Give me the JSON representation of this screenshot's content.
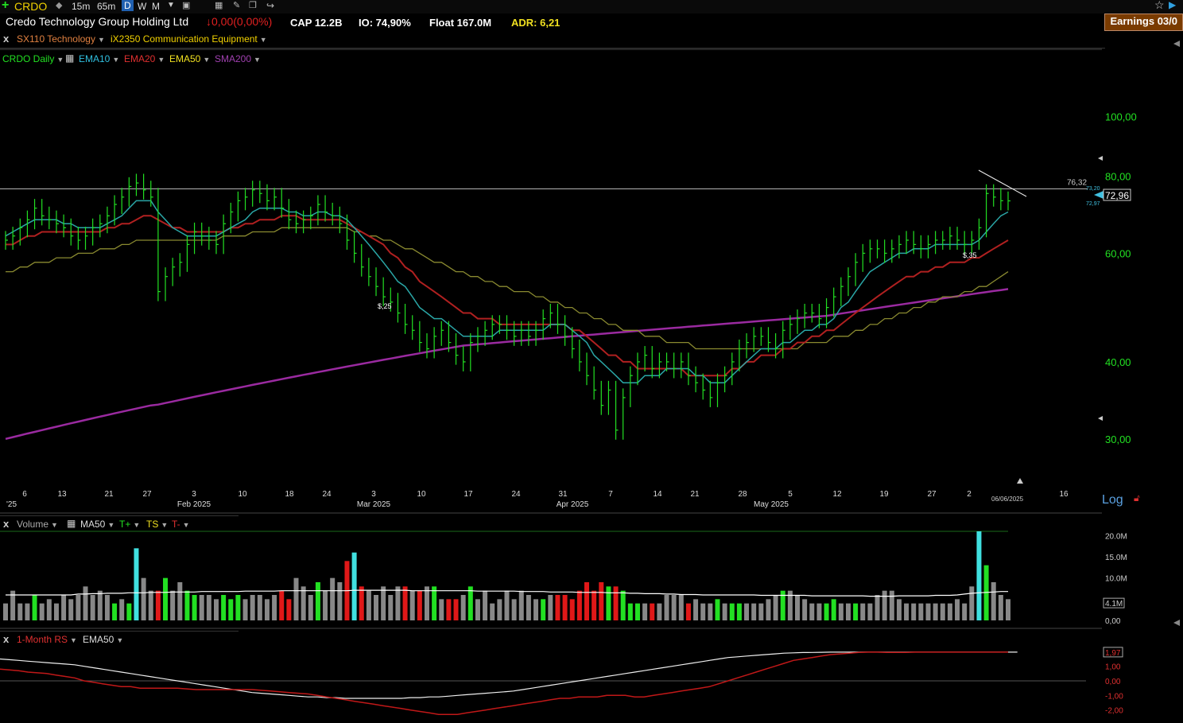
{
  "toolbar": {
    "symbol": "CRDO",
    "intervals": [
      "15m",
      "65m",
      "D",
      "W",
      "M"
    ],
    "active_interval": "D"
  },
  "info": {
    "company": "Credo Technology Group Holding Ltd",
    "change": "↓0,00(0,00%)",
    "cap": "CAP 12.2B",
    "io": "IO: 74,90%",
    "float": "Float 167.0M",
    "adr": "ADR: 6,21",
    "earnings": "Earnings 03/0"
  },
  "sector": {
    "close": "x",
    "sector": "SX110 Technology",
    "industry": "iX2350 Communication Equipment"
  },
  "indicators": {
    "symbol_label": "CRDO Daily",
    "ema10": "EMA10",
    "ema20": "EMA20",
    "ema50": "EMA50",
    "sma200": "SMA200"
  },
  "volume_panel": {
    "close": "x",
    "label": "Volume",
    "ma": "MA50",
    "tplus": "T+",
    "ts": "TS",
    "tminus": "T-"
  },
  "rs_panel": {
    "close": "x",
    "label": "1-Month RS",
    "ema": "EMA50"
  },
  "log_label": "Log",
  "colors": {
    "up_bar": "#22e022",
    "ema10": "#2aa6a6",
    "ema20": "#b02020",
    "ema50": "#8a8a30",
    "sma200": "#9a2aa0",
    "vol_up": "#22e022",
    "vol_down": "#e01818",
    "vol_flat": "#888888",
    "vol_yellow": "#f0e020",
    "vol_cyan": "#40e0e0"
  },
  "chart_data": {
    "type": "ohlc",
    "scale": "log",
    "ylim": [
      26,
      120
    ],
    "y_ticks": [
      "100,00",
      "80,00",
      "60,00",
      "40,00",
      "30,00"
    ],
    "y_tick_values": [
      100,
      80,
      60,
      40,
      30
    ],
    "x_ticks": [
      "6",
      "13",
      "21",
      "27",
      "3",
      "10",
      "18",
      "24",
      "3",
      "10",
      "17",
      "24",
      "31",
      "7",
      "14",
      "21",
      "28",
      "5",
      "12",
      "19",
      "27",
      "2",
      "16"
    ],
    "x_months": [
      "Feb 2025",
      "Mar 2025",
      "Apr 2025",
      "May 2025"
    ],
    "x_left_label": "'25",
    "date_label": "06/06/2025",
    "horizontal_line": "76,32",
    "last_price": "72,96",
    "small_prices": [
      "73,20",
      "72,97"
    ],
    "annotations": [
      "$,25",
      "$,35"
    ],
    "closes": [
      63,
      64,
      66,
      68,
      71,
      69,
      68,
      67,
      66,
      64,
      63,
      64,
      66,
      67,
      69,
      72,
      74,
      77,
      78,
      76,
      74,
      52,
      55,
      57,
      58,
      62,
      65,
      64,
      63,
      62,
      67,
      70,
      73,
      74,
      76,
      75,
      73,
      74,
      71,
      68,
      67,
      68,
      69,
      72,
      70,
      69,
      67,
      63,
      60,
      57,
      55,
      53,
      51,
      50,
      48,
      46,
      45,
      43,
      42,
      44,
      45,
      43,
      41,
      40,
      43,
      44,
      45,
      46,
      46,
      45,
      44,
      45,
      44,
      45,
      47,
      48,
      46,
      44,
      42,
      40,
      38,
      36,
      34,
      36,
      31,
      35,
      38,
      40,
      41,
      39,
      40,
      40,
      39,
      40,
      38,
      37,
      36,
      35,
      37,
      38,
      40,
      42,
      43,
      44,
      44,
      43,
      42,
      45,
      46,
      47,
      48,
      48,
      47,
      49,
      51,
      53,
      55,
      58,
      60,
      61,
      61,
      60,
      61,
      62,
      63,
      62,
      61,
      62,
      63,
      63,
      64,
      63,
      62,
      63,
      66,
      75,
      74,
      73,
      72.96
    ],
    "ema10": [
      64,
      65,
      66,
      67,
      68,
      68,
      68,
      68,
      67,
      67,
      66,
      66,
      66,
      66,
      67,
      68,
      69,
      71,
      73,
      73,
      73,
      70,
      68,
      66,
      65,
      64,
      64,
      64,
      64,
      64,
      65,
      66,
      67,
      68,
      70,
      71,
      71,
      71,
      71,
      70,
      70,
      69,
      69,
      70,
      70,
      69,
      69,
      68,
      66,
      64,
      62,
      60,
      58,
      56,
      54,
      53,
      51,
      49,
      48,
      47,
      47,
      46,
      45,
      44,
      44,
      44,
      44,
      44,
      45,
      45,
      45,
      45,
      45,
      45,
      45,
      46,
      46,
      46,
      45,
      44,
      43,
      41,
      40,
      39,
      38,
      37,
      37,
      37,
      38,
      38,
      38,
      39,
      39,
      39,
      39,
      38,
      38,
      37,
      37,
      37,
      38,
      39,
      40,
      41,
      42,
      42,
      42,
      43,
      43,
      44,
      45,
      45,
      46,
      46,
      47,
      49,
      50,
      52,
      54,
      56,
      57,
      58,
      59,
      60,
      60,
      61,
      61,
      61,
      62,
      62,
      62,
      62,
      62,
      62,
      63,
      65,
      67,
      69,
      70
    ],
    "ema20": [
      62,
      62,
      63,
      64,
      64,
      65,
      65,
      65,
      65,
      65,
      65,
      65,
      65,
      65,
      66,
      66,
      67,
      67,
      68,
      69,
      69,
      68,
      67,
      66,
      66,
      65,
      65,
      65,
      65,
      65,
      65,
      66,
      66,
      67,
      67,
      68,
      68,
      68,
      69,
      69,
      69,
      68,
      68,
      68,
      68,
      68,
      68,
      67,
      66,
      65,
      64,
      63,
      62,
      60,
      59,
      57,
      56,
      54,
      53,
      52,
      51,
      50,
      49,
      48,
      48,
      47,
      47,
      47,
      46,
      46,
      46,
      46,
      46,
      46,
      46,
      46,
      46,
      46,
      45,
      45,
      44,
      43,
      42,
      41,
      41,
      40,
      40,
      39,
      39,
      39,
      39,
      39,
      39,
      39,
      38,
      38,
      38,
      38,
      38,
      38,
      39,
      39,
      40,
      40,
      41,
      41,
      41,
      42,
      42,
      43,
      43,
      44,
      44,
      45,
      45,
      46,
      47,
      48,
      49,
      50,
      51,
      52,
      53,
      54,
      55,
      55,
      56,
      56,
      57,
      57,
      58,
      58,
      58,
      59,
      59,
      60,
      61,
      62,
      63
    ],
    "ema50": [
      56,
      56,
      57,
      57,
      58,
      58,
      58,
      59,
      59,
      59,
      60,
      60,
      60,
      61,
      61,
      61,
      62,
      62,
      63,
      63,
      63,
      63,
      63,
      63,
      63,
      63,
      63,
      63,
      63,
      63,
      64,
      64,
      64,
      64,
      65,
      65,
      65,
      65,
      66,
      66,
      66,
      66,
      66,
      66,
      66,
      66,
      66,
      66,
      65,
      65,
      64,
      64,
      63,
      63,
      62,
      61,
      61,
      60,
      59,
      58,
      58,
      57,
      56,
      56,
      55,
      55,
      54,
      54,
      53,
      53,
      52,
      52,
      52,
      51,
      51,
      50,
      50,
      49,
      49,
      48,
      48,
      47,
      47,
      46,
      46,
      45,
      45,
      45,
      44,
      44,
      44,
      43,
      43,
      43,
      43,
      42,
      42,
      42,
      42,
      42,
      42,
      42,
      42,
      42,
      42,
      42,
      42,
      42,
      42,
      42,
      43,
      43,
      43,
      43,
      44,
      44,
      44,
      45,
      45,
      46,
      46,
      47,
      47,
      48,
      48,
      49,
      49,
      50,
      50,
      51,
      51,
      51,
      52,
      52,
      53,
      53,
      54,
      55,
      56
    ],
    "sma200": [
      30,
      30.2,
      30.4,
      30.6,
      30.8,
      31,
      31.2,
      31.4,
      31.6,
      31.8,
      32,
      32.2,
      32.4,
      32.6,
      32.8,
      33,
      33.2,
      33.4,
      33.6,
      33.8,
      34,
      34.1,
      34.3,
      34.5,
      34.7,
      34.9,
      35.1,
      35.3,
      35.5,
      35.7,
      35.9,
      36.1,
      36.3,
      36.5,
      36.7,
      36.9,
      37.1,
      37.3,
      37.5,
      37.7,
      37.9,
      38.1,
      38.3,
      38.5,
      38.7,
      38.9,
      39.1,
      39.3,
      39.5,
      39.7,
      39.9,
      40.1,
      40.3,
      40.5,
      40.7,
      40.9,
      41.1,
      41.3,
      41.5,
      41.7,
      41.9,
      42.1,
      42.3,
      42.5,
      42.6,
      42.7,
      42.8,
      42.9,
      43,
      43.1,
      43.2,
      43.3,
      43.4,
      43.5,
      43.6,
      43.7,
      43.8,
      43.9,
      44,
      44.1,
      44.2,
      44.3,
      44.4,
      44.5,
      44.6,
      44.7,
      44.8,
      44.9,
      45,
      45.1,
      45.2,
      45.3,
      45.4,
      45.5,
      45.6,
      45.7,
      45.8,
      45.9,
      46,
      46.1,
      46.2,
      46.3,
      46.4,
      46.5,
      46.6,
      46.7,
      46.8,
      46.9,
      47,
      47.1,
      47.2,
      47.3,
      47.4,
      47.5,
      47.7,
      47.9,
      48.1,
      48.3,
      48.5,
      48.7,
      48.9,
      49.1,
      49.3,
      49.5,
      49.7,
      49.9,
      50.1,
      50.3,
      50.5,
      50.7,
      50.9,
      51.1,
      51.3,
      51.5,
      51.7,
      51.9,
      52.1,
      52.3,
      52.5
    ],
    "volume_ticks": [
      "20.0M",
      "15.0M",
      "10.0M",
      "4.1M",
      "0,00"
    ],
    "volume_tick_values": [
      20,
      15,
      10,
      4.1,
      0
    ],
    "volume": [
      4,
      7,
      4,
      4,
      6,
      4,
      5,
      4,
      6,
      5,
      6,
      8,
      6,
      7,
      6,
      4,
      5,
      4,
      17,
      10,
      7,
      7,
      10,
      7,
      9,
      7,
      6,
      6,
      6,
      5,
      6,
      5,
      6,
      5,
      6,
      6,
      5,
      6,
      7,
      5,
      10,
      8,
      6,
      9,
      7,
      10,
      9,
      14,
      16,
      8,
      7,
      6,
      8,
      6,
      8,
      8,
      7,
      7,
      8,
      8,
      5,
      5,
      5,
      6,
      8,
      5,
      7,
      4,
      5,
      7,
      5,
      7,
      6,
      5,
      5,
      6,
      6,
      6,
      5,
      7,
      9,
      7,
      9,
      8,
      8,
      7,
      4,
      4,
      4,
      4,
      4,
      6,
      6,
      6,
      4,
      5,
      4,
      4,
      5,
      4,
      4,
      4,
      4,
      4,
      4,
      5,
      6,
      7,
      7,
      6,
      5,
      4,
      4,
      4,
      5,
      4,
      4,
      4,
      4,
      4,
      6,
      7,
      7,
      5,
      4,
      4,
      4,
      4,
      4,
      4,
      4,
      5,
      4,
      8,
      21,
      13,
      9,
      6,
      5
    ],
    "vol_ma50": [
      6,
      6,
      6,
      6,
      6,
      6,
      6,
      6,
      6,
      6,
      6.2,
      6.2,
      6.3,
      6.3,
      6.4,
      6.4,
      6.4,
      6.5,
      6.5,
      6.5,
      6.6,
      6.6,
      6.6,
      6.7,
      6.7,
      6.7,
      6.7,
      6.8,
      6.8,
      6.8,
      6.8,
      6.8,
      6.8,
      6.9,
      6.9,
      6.9,
      6.9,
      6.9,
      7,
      7,
      7,
      7,
      7,
      7,
      7,
      7,
      7,
      7,
      7.1,
      7.1,
      7.1,
      7.1,
      7.1,
      7.1,
      7.1,
      7.1,
      7,
      7,
      7,
      7,
      7,
      7,
      7,
      7,
      7,
      6.9,
      6.9,
      6.9,
      6.9,
      6.9,
      6.9,
      6.8,
      6.8,
      6.8,
      6.8,
      6.7,
      6.7,
      6.7,
      6.7,
      6.6,
      6.6,
      6.6,
      6.6,
      6.5,
      6.5,
      6.5,
      6.4,
      6.4,
      6.3,
      6.3,
      6.3,
      6.2,
      6.2,
      6.1,
      6.1,
      6.1,
      6,
      6,
      6,
      6,
      6,
      6,
      6,
      6,
      5.9,
      5.9,
      5.9,
      5.9,
      5.9,
      5.9,
      5.9,
      5.8,
      5.8,
      5.8,
      5.8,
      5.8,
      5.8,
      5.8,
      5.8,
      5.7,
      5.7,
      5.7,
      5.7,
      5.8,
      5.8,
      5.8,
      5.8,
      5.8,
      5.9,
      5.9,
      5.9,
      6,
      6.2,
      6.4,
      6.5,
      6.6,
      6.7,
      6.8,
      6.8
    ],
    "rs_ticks": [
      "1,97",
      "1,00",
      "0,00",
      "-1,00",
      "-2,00"
    ],
    "rs_tick_values": [
      1.97,
      1,
      0,
      -1,
      -2
    ],
    "rs": [
      0.8,
      0.75,
      0.7,
      0.6,
      0.55,
      0.5,
      0.4,
      0.3,
      0.2,
      0,
      -0.1,
      -0.2,
      -0.3,
      -0.4,
      -0.4,
      -0.5,
      -0.5,
      -0.5,
      -0.5,
      -0.5,
      -0.55,
      -0.6,
      -0.6,
      -0.6,
      -0.6,
      -0.6,
      -0.6,
      -0.6,
      -0.65,
      -0.7,
      -0.75,
      -0.8,
      -0.85,
      -0.9,
      -1,
      -1.1,
      -1.2,
      -1.3,
      -1.4,
      -1.5,
      -1.6,
      -1.7,
      -1.8,
      -1.9,
      -2,
      -2.1,
      -2.2,
      -2.3,
      -2.3,
      -2.3,
      -2.2,
      -2.1,
      -2,
      -1.9,
      -1.8,
      -1.7,
      -1.6,
      -1.5,
      -1.4,
      -1.3,
      -1.2,
      -1.2,
      -1.1,
      -1.1,
      -1.1,
      -1,
      -1,
      -1,
      -1.1,
      -1.1,
      -1,
      -0.9,
      -0.8,
      -0.7,
      -0.6,
      -0.5,
      -0.4,
      -0.2,
      0,
      0.2,
      0.4,
      0.6,
      0.8,
      1,
      1.2,
      1.4,
      1.5,
      1.6,
      1.7,
      1.8,
      1.85,
      1.9,
      1.95,
      1.97,
      1.97,
      1.95,
      1.95,
      1.95,
      1.97,
      1.97,
      1.97,
      1.97,
      1.97,
      1.97,
      1.97,
      1.97,
      1.97,
      1.97,
      1.97
    ],
    "rs_ema50": [
      1.5,
      1.45,
      1.4,
      1.35,
      1.3,
      1.25,
      1.2,
      1.15,
      1.1,
      1,
      0.9,
      0.8,
      0.7,
      0.6,
      0.5,
      0.4,
      0.3,
      0.2,
      0.1,
      0,
      -0.1,
      -0.2,
      -0.3,
      -0.4,
      -0.5,
      -0.6,
      -0.7,
      -0.8,
      -0.85,
      -0.9,
      -0.95,
      -1,
      -1.05,
      -1.1,
      -1.1,
      -1.15,
      -1.15,
      -1.2,
      -1.2,
      -1.2,
      -1.2,
      -1.2,
      -1.2,
      -1.2,
      -1.15,
      -1.15,
      -1.1,
      -1.1,
      -1.05,
      -1,
      -0.95,
      -0.9,
      -0.85,
      -0.8,
      -0.75,
      -0.7,
      -0.6,
      -0.5,
      -0.4,
      -0.3,
      -0.2,
      -0.1,
      0,
      0.1,
      0.2,
      0.3,
      0.4,
      0.5,
      0.6,
      0.7,
      0.8,
      0.9,
      1,
      1.1,
      1.2,
      1.3,
      1.4,
      1.5,
      1.6,
      1.65,
      1.7,
      1.75,
      1.8,
      1.85,
      1.9,
      1.92,
      1.94,
      1.95,
      1.96,
      1.97,
      1.97,
      1.97,
      1.97,
      1.97,
      1.97,
      1.97,
      1.97,
      1.97,
      1.97,
      1.97,
      1.97,
      1.97,
      1.97,
      1.97,
      1.97,
      1.97,
      1.97,
      1.97,
      1.97,
      1.97
    ]
  }
}
